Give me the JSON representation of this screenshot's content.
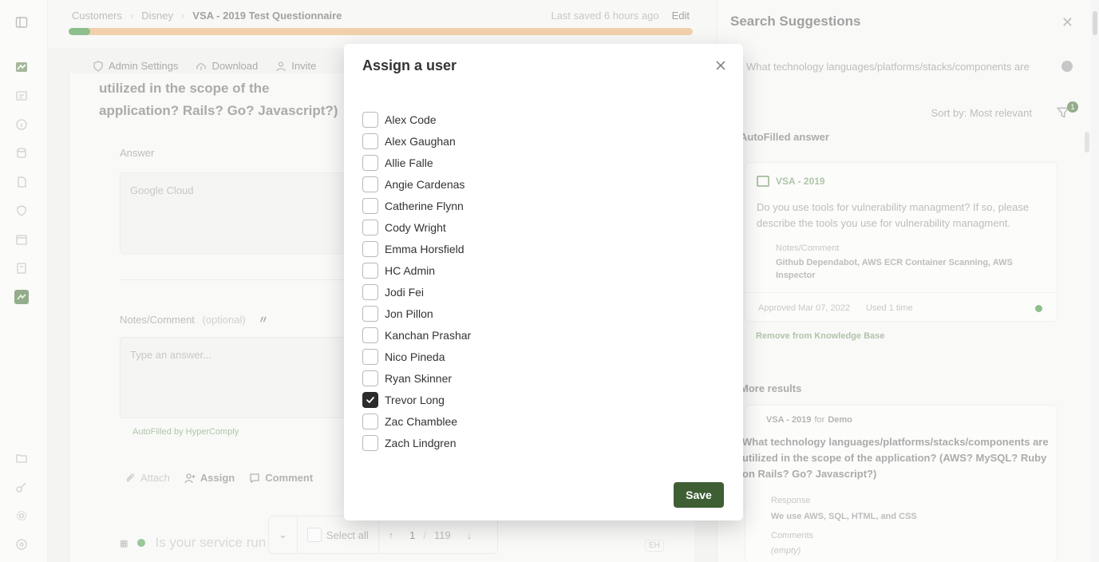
{
  "colors": {
    "brand_green": "#3e5e34",
    "progress_done": "#2f8a2f",
    "progress_todo": "#e5ab66"
  },
  "breadcrumb": {
    "items": [
      "Customers",
      "Disney"
    ],
    "current": "VSA - 2019 Test Questionnaire"
  },
  "header": {
    "last_saved": "Last saved 6 hours ago",
    "edit_label": "Edit",
    "progress_fraction": 0.034
  },
  "toolbar": {
    "admin_settings": "Admin Settings",
    "download": "Download",
    "invite": "Invite"
  },
  "question": {
    "text": "utilized in the scope of the application? Rails? Go? Javascript?)",
    "answer_label": "Answer",
    "answer_value": "Google Cloud",
    "notes_label": "Notes/Comment",
    "notes_optional": "(optional)",
    "notes_placeholder": "Type an answer...",
    "autofilled_by": "AutoFilled by HyperComply"
  },
  "actions": {
    "attach": "Attach",
    "assign": "Assign",
    "comment": "Comment"
  },
  "bottom_bar": {
    "select_all": "Select all",
    "current_page": "1",
    "sep": "/",
    "total_pages": "119"
  },
  "next_question": "Is your service run from",
  "kbd_hint": "EH",
  "search_panel": {
    "title": "Search Suggestions",
    "query": "What technology languages/platforms/stacks/components are",
    "sort_label": "Sort by: Most relevant",
    "filter_count": "1",
    "autofilled_heading": "AutoFilled answer",
    "card1": {
      "source": "VSA - 2019",
      "question": "Do you use tools for vulnerability managment? If so, please describe the tools you use for vulnerability managment.",
      "notes_label": "Notes/Comment",
      "notes": "Github Dependabot, AWS ECR Container Scanning, AWS Inspector",
      "approved": "Approved Mar 07, 2022",
      "used": "Used 1 time",
      "remove_label": "Remove from Knowledge Base"
    },
    "more_heading": "More results",
    "card2": {
      "source": "VSA - 2019",
      "for_label": "for",
      "customer": "Demo",
      "question": "What technology languages/platforms/stacks/components are utilized in the scope of the application? (AWS? MySQL? Ruby on Rails? Go? Javascript?)",
      "response_label": "Response",
      "response": "We use AWS, SQL, HTML, and CSS",
      "comments_label": "Comments",
      "comments": "(empty)"
    }
  },
  "modal": {
    "title": "Assign a user",
    "save_label": "Save",
    "users": [
      {
        "name": "Alex Code",
        "checked": false
      },
      {
        "name": "Alex Gaughan",
        "checked": false
      },
      {
        "name": "Allie Falle",
        "checked": false
      },
      {
        "name": "Angie Cardenas",
        "checked": false
      },
      {
        "name": "Catherine Flynn",
        "checked": false
      },
      {
        "name": "Cody Wright",
        "checked": false
      },
      {
        "name": "Emma Horsfield",
        "checked": false
      },
      {
        "name": "HC Admin",
        "checked": false
      },
      {
        "name": "Jodi Fei",
        "checked": false
      },
      {
        "name": "Jon Pillon",
        "checked": false
      },
      {
        "name": "Kanchan Prashar",
        "checked": false
      },
      {
        "name": "Nico Pineda",
        "checked": false
      },
      {
        "name": "Ryan Skinner",
        "checked": false
      },
      {
        "name": "Trevor Long",
        "checked": true
      },
      {
        "name": "Zac Chamblee",
        "checked": false
      },
      {
        "name": "Zach Lindgren",
        "checked": false
      }
    ]
  }
}
